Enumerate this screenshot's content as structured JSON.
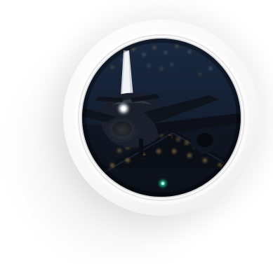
{
  "graphic": {
    "icon": "airplane-icon",
    "colors": {
      "background": "#ffffff",
      "ring": "#f7f7f7",
      "sky_top": "#1b2b44",
      "sky_bottom": "#0b111c",
      "runway": "#0b0f17",
      "light_warm": "#ffcf66",
      "light_cool": "#2dffc0"
    }
  }
}
